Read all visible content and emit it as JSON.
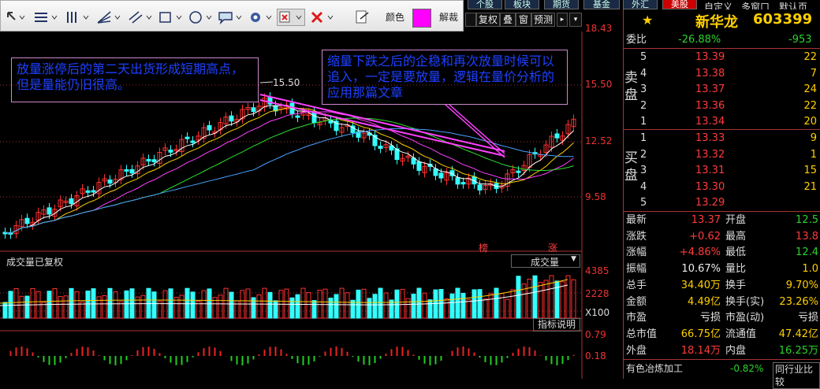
{
  "toolbar": {
    "color_label": "颜色",
    "unlock_label": "解裁",
    "swatch_color": "#ff00ff",
    "icons": [
      "chevron-down-icon",
      "text-align-icon",
      "parallel-lines-icon",
      "fan-lines-icon",
      "channel-icon",
      "rectangle-icon",
      "ellipse-icon",
      "callout-icon",
      "gear-icon",
      "delete-drawing-icon",
      "close-x-icon",
      "export-icon"
    ]
  },
  "top_tabs": [
    "个股",
    "板块",
    "期货",
    "基金",
    "外汇",
    "美股"
  ],
  "sub_tabs": [
    "复权",
    "叠",
    "窗",
    "预测"
  ],
  "menu_tabs": [
    "自定义",
    "多窗口",
    "默认页"
  ],
  "header": {
    "star": "★",
    "stock_name": "新华龙",
    "stock_code": "603399"
  },
  "price_axis": [
    "18.43",
    "15.50",
    "12.52",
    "9.58"
  ],
  "volume_axis": [
    "4385",
    "2228",
    "X100"
  ],
  "indicator_axis": [
    "0.79",
    "0.18"
  ],
  "chart_markers": {
    "high_label": "15.50",
    "tag_bang": "榜",
    "tag_zhang": "涨"
  },
  "volume_panel": {
    "title": "成交量已复权",
    "dropdown": "成交量",
    "indicator_btn": "指标说明"
  },
  "notes": [
    "放量涨停后的第二天出货形成短期高点，但是量能仍旧很高。",
    "缩量下跌之后的企稳和再次放量时候可以追入，一定是要放量，逻辑在量价分析的应用那篇文章"
  ],
  "weibi": {
    "label": "委比",
    "value": "-26.88%",
    "diff": "-953"
  },
  "sell_side": {
    "label": "卖盘",
    "rows": [
      {
        "level": "5",
        "price": "13.39",
        "vol": "22"
      },
      {
        "level": "4",
        "price": "13.38",
        "vol": "7"
      },
      {
        "level": "3",
        "price": "13.37",
        "vol": "24"
      },
      {
        "level": "2",
        "price": "13.36",
        "vol": "22"
      },
      {
        "level": "1",
        "price": "13.34",
        "vol": "20"
      }
    ]
  },
  "buy_side": {
    "label": "买盘",
    "rows": [
      {
        "level": "1",
        "price": "13.33",
        "vol": "9"
      },
      {
        "level": "2",
        "price": "13.32",
        "vol": "1"
      },
      {
        "level": "3",
        "price": "13.31",
        "vol": "15"
      },
      {
        "level": "4",
        "price": "13.30",
        "vol": "21"
      },
      {
        "level": "5",
        "price": "13.29",
        "vol": ""
      }
    ]
  },
  "stats": [
    {
      "l1": "最新",
      "v1": "13.37",
      "c1": "red",
      "l2": "开盘",
      "v2": "12.5",
      "c2": "green"
    },
    {
      "l1": "涨跌",
      "v1": "+0.62",
      "c1": "red",
      "l2": "最高",
      "v2": "13.8",
      "c2": "red"
    },
    {
      "l1": "涨幅",
      "v1": "+4.86%",
      "c1": "red",
      "l2": "最低",
      "v2": "12.4",
      "c2": "green"
    },
    {
      "l1": "振幅",
      "v1": "10.67%",
      "c1": "white",
      "l2": "量比",
      "v2": "1.0",
      "c2": "yellow"
    },
    {
      "l1": "总手",
      "v1": "34.40万",
      "c1": "yellow",
      "l2": "换手",
      "v2": "9.70%",
      "c2": "yellow"
    },
    {
      "l1": "金额",
      "v1": "4.49亿",
      "c1": "yellow",
      "l2": "换手(实)",
      "v2": "23.26%",
      "c2": "yellow"
    },
    {
      "l1": "市盈",
      "v1": "亏损",
      "c1": "white",
      "l2": "市盈(动)",
      "v2": "亏损",
      "c2": "white"
    },
    {
      "l1": "总市值",
      "v1": "66.75亿",
      "c1": "yellow",
      "l2": "流通值",
      "v2": "47.42亿",
      "c2": "yellow"
    },
    {
      "l1": "外盘",
      "v1": "18.14万",
      "c1": "red",
      "l2": "内盘",
      "v2": "16.25万",
      "c2": "green"
    }
  ],
  "footer": {
    "industry": "有色冶炼加工",
    "industry_change": "-0.82%",
    "compare": "同行业比较"
  }
}
